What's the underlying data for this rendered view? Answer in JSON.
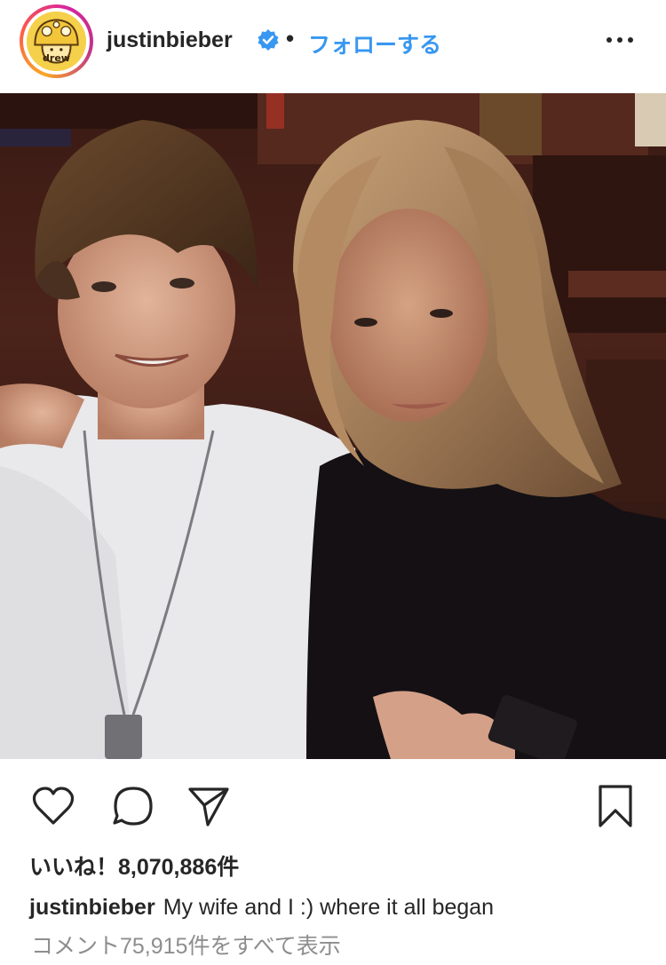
{
  "header": {
    "username": "justinbieber",
    "separator": "•",
    "follow_label": "フォローする",
    "avatar_icon": "mushroom-drew-logo",
    "verified_icon": "verified-badge-icon",
    "more_icon": "more-options-icon",
    "avatar_text": "drew"
  },
  "post": {
    "image_alt": "Two young people posing together in a dimly lit restaurant"
  },
  "actions": {
    "like_icon": "heart-icon",
    "comment_icon": "comment-icon",
    "share_icon": "share-icon",
    "save_icon": "bookmark-icon"
  },
  "likes": {
    "text": "いいね！8,070,886件"
  },
  "caption": {
    "username": "justinbieber",
    "text": "My wife and I :) where it all began"
  },
  "comments": {
    "text": "コメント75,915件をすべて表示"
  },
  "colors": {
    "accent": "#3897f0",
    "text": "#262626",
    "muted": "#8e8e8e"
  }
}
